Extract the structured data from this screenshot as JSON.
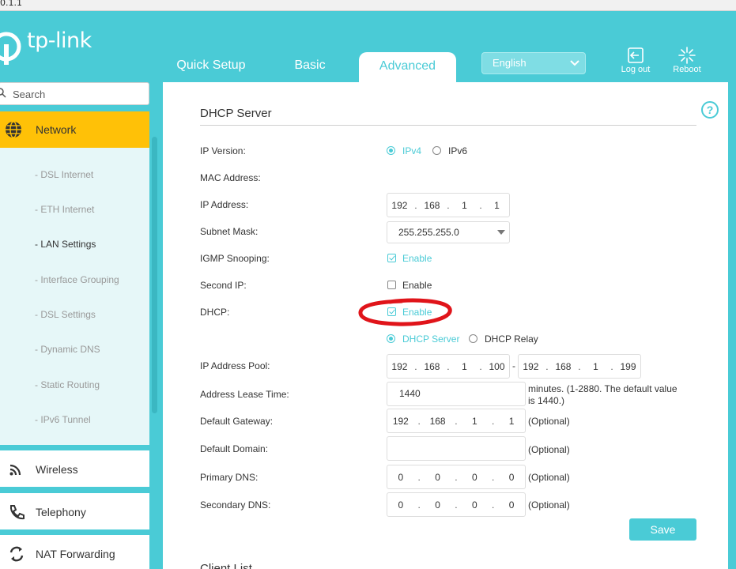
{
  "address_bar": {
    "text": "0.1.1"
  },
  "brand": {
    "logo_text": "tp-link"
  },
  "header": {
    "tabs": [
      {
        "label": "Quick Setup"
      },
      {
        "label": "Basic"
      },
      {
        "label": "Advanced",
        "active": true
      }
    ],
    "language": {
      "selected": "English"
    },
    "logout_label": "Log out",
    "reboot_label": "Reboot"
  },
  "sidebar": {
    "search_placeholder": "Search",
    "active": {
      "label": "Network",
      "icon": "globe-icon"
    },
    "sub_items": [
      "- DSL Internet",
      "- ETH Internet",
      "- LAN Settings",
      "- Interface Grouping",
      "- DSL Settings",
      "- Dynamic DNS",
      "- Static Routing",
      "- IPv6 Tunnel"
    ],
    "selected_sub_index": 2,
    "items": [
      {
        "label": "Wireless",
        "icon": "wifi-icon"
      },
      {
        "label": "Telephony",
        "icon": "phone-icon"
      },
      {
        "label": "NAT Forwarding",
        "icon": "nat-icon"
      }
    ]
  },
  "form": {
    "title": "DHCP Server",
    "ip_version": {
      "label": "IP Version:",
      "options": [
        "IPv4",
        "IPv6"
      ],
      "selected": "IPv4"
    },
    "mac_address": {
      "label": "MAC Address:",
      "value": ""
    },
    "ip_address": {
      "label": "IP Address:",
      "octets": [
        "192",
        "168",
        "1",
        "1"
      ]
    },
    "subnet_mask": {
      "label": "Subnet Mask:",
      "value": "255.255.255.0"
    },
    "igmp_snooping": {
      "label": "IGMP Snooping:",
      "option": "Enable",
      "checked": true
    },
    "second_ip": {
      "label": "Second IP:",
      "option": "Enable",
      "checked": false
    },
    "dhcp": {
      "label": "DHCP:",
      "option": "Enable",
      "checked": true
    },
    "dhcp_mode": {
      "options": [
        "DHCP Server",
        "DHCP Relay"
      ],
      "selected": "DHCP Server"
    },
    "ip_pool": {
      "label": "IP Address Pool:",
      "start": [
        "192",
        "168",
        "1",
        "100"
      ],
      "end": [
        "192",
        "168",
        "1",
        "199"
      ],
      "separator": "-"
    },
    "lease_time": {
      "label": "Address Lease Time:",
      "value": "1440",
      "note_line1": "minutes. (1-2880. The default value",
      "note_line2": "is 1440.)"
    },
    "default_gateway": {
      "label": "Default Gateway:",
      "octets": [
        "192",
        "168",
        "1",
        "1"
      ],
      "note": "(Optional)"
    },
    "default_domain": {
      "label": "Default Domain:",
      "value": "",
      "note": "(Optional)"
    },
    "primary_dns": {
      "label": "Primary DNS:",
      "octets": [
        "0",
        "0",
        "0",
        "0"
      ],
      "note": "(Optional)"
    },
    "secondary_dns": {
      "label": "Secondary DNS:",
      "octets": [
        "0",
        "0",
        "0",
        "0"
      ],
      "note": "(Optional)"
    },
    "save_label": "Save",
    "next_section_title": "Client List"
  },
  "colors": {
    "accent": "#4acbd6",
    "active_nav": "#ffc107",
    "annotation": "#e0141a"
  }
}
